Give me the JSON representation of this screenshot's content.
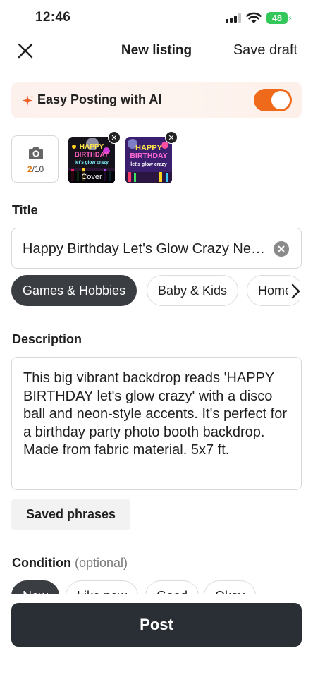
{
  "status_bar": {
    "time": "12:46",
    "battery": "48",
    "icons": [
      "cellular-signal-icon",
      "wifi-icon",
      "battery-charging-icon"
    ]
  },
  "header": {
    "title": "New listing",
    "save_draft_label": "Save draft",
    "close_icon": "close-icon"
  },
  "ai_banner": {
    "label": "Easy Posting with AI",
    "enabled": true,
    "accent_color": "#f06a1c",
    "icon": "sparkle-icon"
  },
  "photos": {
    "count_current": "2",
    "count_max": "/10",
    "camera_icon": "camera-icon",
    "cover_label": "Cover",
    "items": [
      {
        "line1": "HAPPY",
        "line2": "BIRTHDAY",
        "line3": "let's glow crazy"
      },
      {
        "line1": "HAPPY",
        "line2": "BIRTHDAY",
        "line3": "let's glow crazy"
      }
    ]
  },
  "title_section": {
    "label": "Title",
    "value": "Happy Birthday Let's Glow Crazy Neon Backdrop"
  },
  "categories": {
    "items": [
      "Games & Hobbies",
      "Baby & Kids",
      "Home"
    ],
    "selected": "Games & Hobbies"
  },
  "description": {
    "label": "Description",
    "value": "This big vibrant backdrop reads 'HAPPY BIRTHDAY let's glow crazy' with a disco ball and neon-style accents. It's perfect for a birthday party photo booth backdrop. Made from fabric material. 5x7 ft."
  },
  "saved_phrases_label": "Saved phrases",
  "condition": {
    "label": "Condition",
    "optional": "(optional)",
    "options": [
      "New",
      "Like new",
      "Good",
      "Okay"
    ],
    "selected": "New"
  },
  "post_label": "Post",
  "colors": {
    "dark_button": "#2a2f35",
    "chip_selected": "#3a3d42",
    "battery": "#34c759"
  }
}
